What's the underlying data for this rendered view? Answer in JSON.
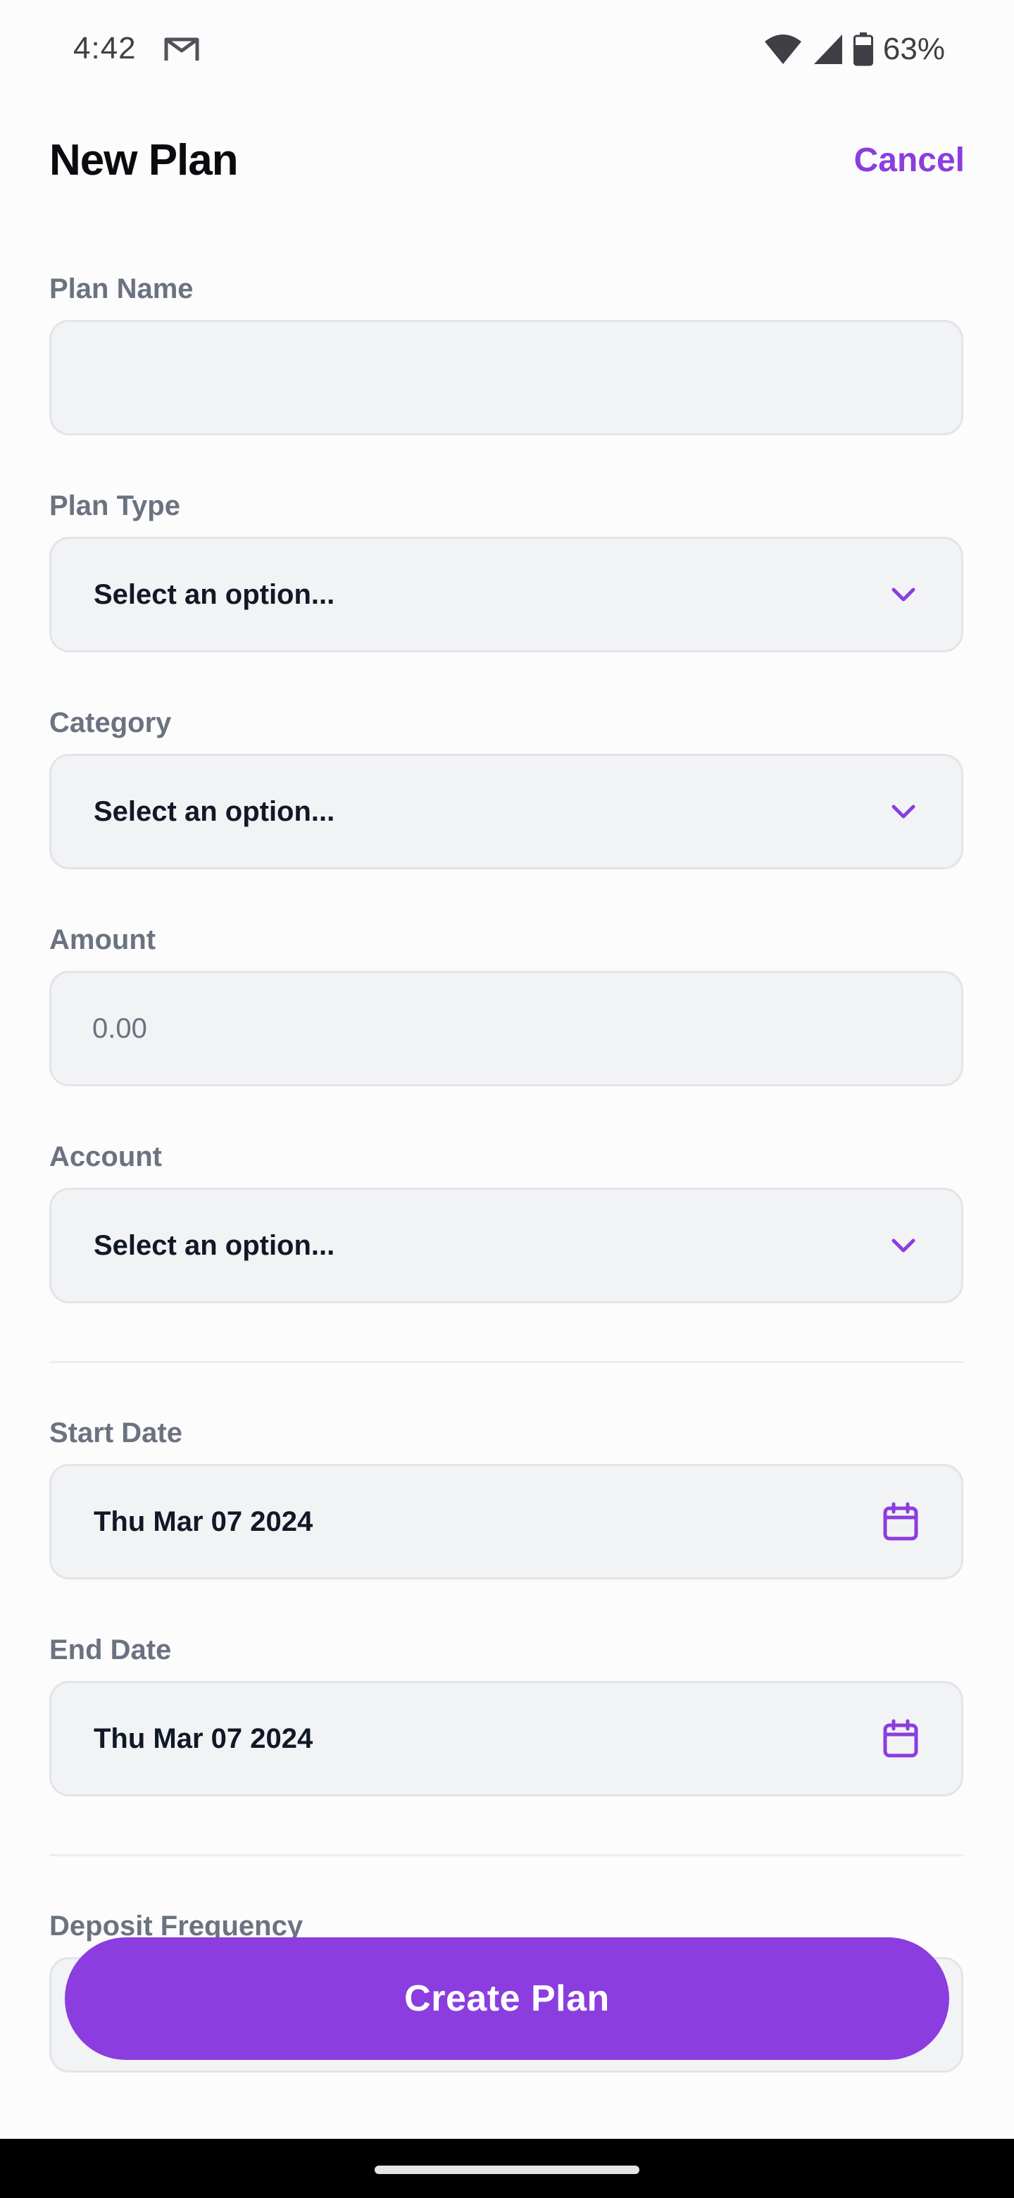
{
  "status_bar": {
    "time": "4:42",
    "battery": "63%",
    "icons": [
      "gmail-icon",
      "wifi-icon",
      "signal-icon",
      "battery-icon"
    ]
  },
  "header": {
    "title": "New Plan",
    "cancel_label": "Cancel"
  },
  "form": {
    "plan_name": {
      "label": "Plan Name",
      "value": "",
      "placeholder": ""
    },
    "plan_type": {
      "label": "Plan Type",
      "value": "Select an option..."
    },
    "category": {
      "label": "Category",
      "value": "Select an option..."
    },
    "amount": {
      "label": "Amount",
      "value": "",
      "placeholder": "0.00"
    },
    "account": {
      "label": "Account",
      "value": "Select an option..."
    },
    "start_date": {
      "label": "Start Date",
      "value": "Thu Mar 07 2024"
    },
    "end_date": {
      "label": "End Date",
      "value": "Thu Mar 07 2024"
    },
    "deposit_frequency": {
      "label": "Deposit Frequency",
      "value": ""
    }
  },
  "actions": {
    "create_label": "Create Plan"
  },
  "colors": {
    "accent": "#8B3DDF",
    "field_bg": "#F2F3F5",
    "label": "#6B7280"
  }
}
